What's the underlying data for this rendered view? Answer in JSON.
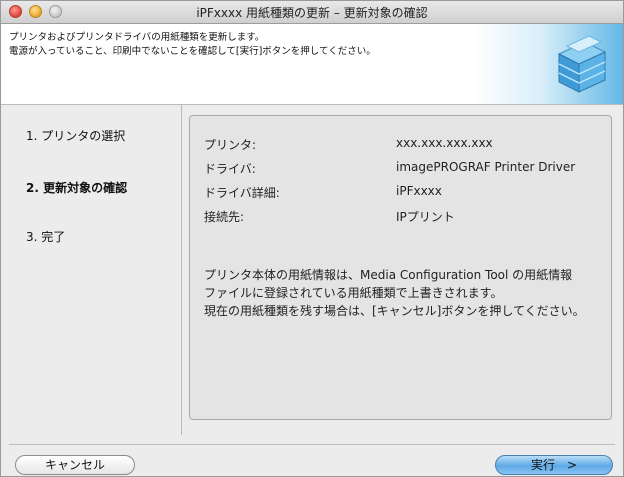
{
  "window": {
    "title": "iPFxxxx 用紙種類の更新 – 更新対象の確認"
  },
  "header": {
    "line1": "プリンタおよびプリンタドライバの用紙種類を更新します。",
    "line2": "電源が入っていること、印刷中でないことを確認して[実行]ボタンを押してください。"
  },
  "steps": [
    {
      "label": "1. プリンタの選択",
      "current": false
    },
    {
      "label": "2. 更新対象の確認",
      "current": true
    },
    {
      "label": "3. 完了",
      "current": false
    }
  ],
  "details": [
    {
      "label": "プリンタ:",
      "value": "xxx.xxx.xxx.xxx"
    },
    {
      "label": "ドライバ:",
      "value": "imagePROGRAF Printer Driver"
    },
    {
      "label": "ドライバ詳細:",
      "value": "iPFxxxx"
    },
    {
      "label": "接続先:",
      "value": "IPプリント"
    }
  ],
  "note": {
    "line1": "プリンタ本体の用紙情報は、Media Configuration Tool の用紙情報",
    "line2": "ファイルに登録されている用紙種類で上書きされます。",
    "line3": "現在の用紙種類を残す場合は、[キャンセル]ボタンを押してください。"
  },
  "buttons": {
    "cancel": "キャンセル",
    "execute": "実行　>"
  },
  "colors": {
    "window_bg": "#ececec",
    "info_box_bg": "#e4e4e4",
    "execute_button": "#5fa9e6"
  }
}
